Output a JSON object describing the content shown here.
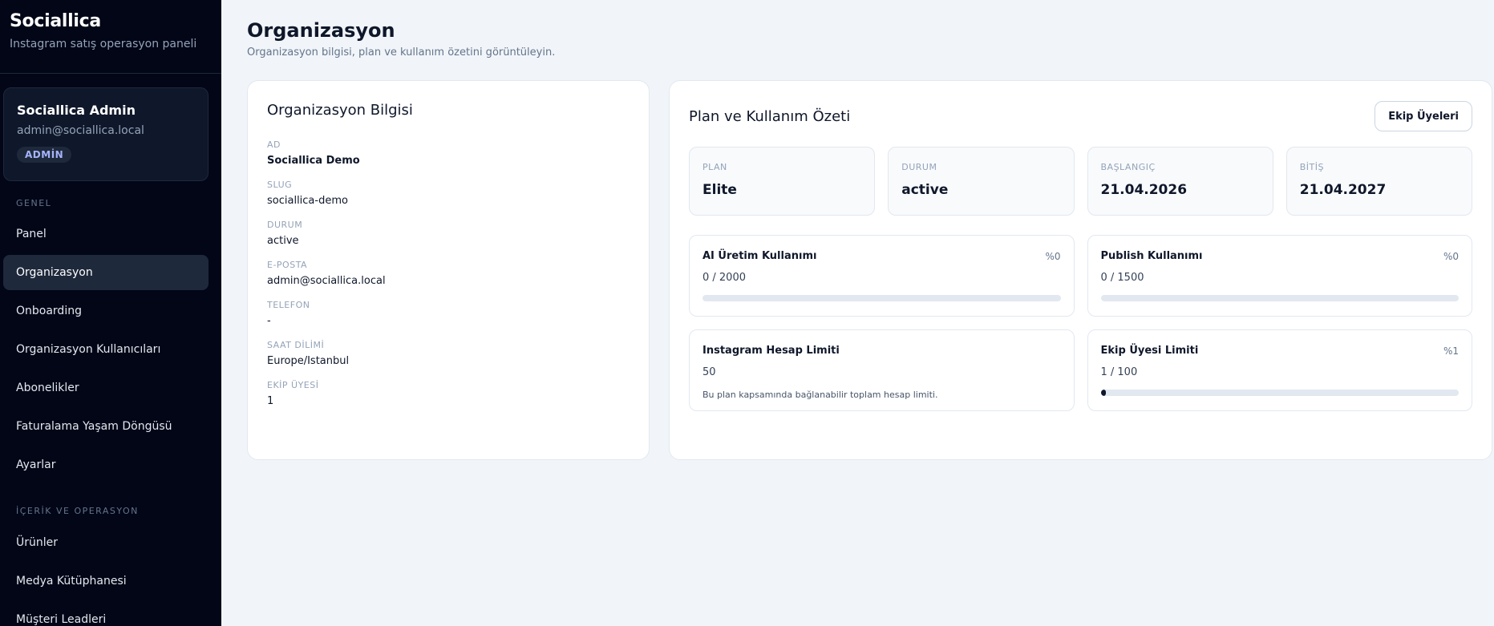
{
  "sidebar": {
    "brand_title": "Sociallica",
    "brand_subtitle": "Instagram satış operasyon paneli",
    "user": {
      "name": "Sociallica Admin",
      "email": "admin@sociallica.local",
      "role": "ADMİN"
    },
    "sections": [
      {
        "label": "GENEL",
        "items": [
          "Panel",
          "Organizasyon",
          "Onboarding",
          "Organizasyon Kullanıcıları",
          "Abonelikler",
          "Faturalama Yaşam Döngüsü",
          "Ayarlar"
        ]
      },
      {
        "label": "İÇERİK VE OPERASYON",
        "items": [
          "Ürünler",
          "Medya Kütüphanesi",
          "Müşteri Leadleri"
        ]
      }
    ],
    "active_item": "Organizasyon"
  },
  "page": {
    "title": "Organizasyon",
    "subtitle": "Organizasyon bilgisi, plan ve kullanım özetini görüntüleyin."
  },
  "org_info": {
    "title": "Organizasyon Bilgisi",
    "fields": [
      {
        "label": "AD",
        "value": "Sociallica Demo"
      },
      {
        "label": "SLUG",
        "value": "sociallica-demo"
      },
      {
        "label": "DURUM",
        "value": "active"
      },
      {
        "label": "E-POSTA",
        "value": "admin@sociallica.local"
      },
      {
        "label": "TELEFON",
        "value": "-"
      },
      {
        "label": "SAAT DİLİMİ",
        "value": "Europe/Istanbul"
      },
      {
        "label": "EKİP ÜYESİ",
        "value": "1"
      }
    ]
  },
  "plan": {
    "title": "Plan ve Kullanım Özeti",
    "team_button": "Ekip Üyeleri",
    "stats": [
      {
        "label": "PLAN",
        "value": "Elite"
      },
      {
        "label": "DURUM",
        "value": "active"
      },
      {
        "label": "BAŞLANGIÇ",
        "value": "21.04.2026"
      },
      {
        "label": "BİTİŞ",
        "value": "21.04.2027"
      }
    ],
    "usage": [
      {
        "title": "AI Üretim Kullanımı",
        "pct": "%0",
        "value": "0 / 2000",
        "fraction": 0
      },
      {
        "title": "Publish Kullanımı",
        "pct": "%0",
        "value": "0 / 1500",
        "fraction": 0
      },
      {
        "title": "Instagram Hesap Limiti",
        "value": "50",
        "note": "Bu plan kapsamında bağlanabilir toplam hesap limiti."
      },
      {
        "title": "Ekip Üyesi Limiti",
        "pct": "%1",
        "value": "1 / 100",
        "fraction": 0.01
      }
    ]
  },
  "colors": {
    "sidebar_bg": "#020617",
    "accent": "#0f172a",
    "page_bg": "#f1f5f9"
  }
}
